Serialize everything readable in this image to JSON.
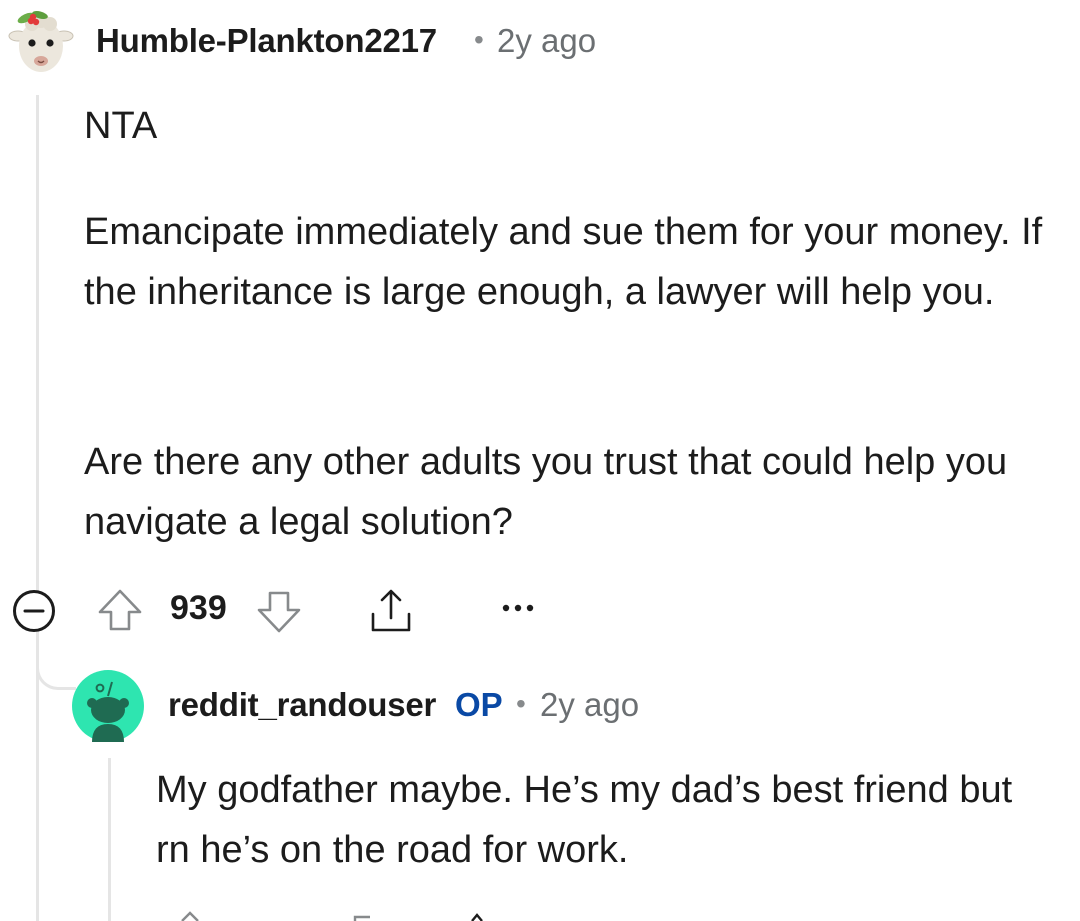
{
  "comment": {
    "username": "Humble-Plankton2217",
    "separator": "•",
    "time": "2y ago",
    "avatar_icon": "snoo-llama-avatar-icon",
    "paragraphs": [
      "NTA",
      "Emancipate immediately and sue them for your money. If the inheritance is large enough, a lawyer will help you.",
      "Are there any other adults you trust that could help you navigate a legal solution?"
    ],
    "actions": {
      "collapse_icon": "minus-circle-icon",
      "upvote_icon": "arrow-up-icon",
      "score": "939",
      "downvote_icon": "arrow-down-icon",
      "share_icon": "share-icon",
      "more_icon": "more-horizontal-icon"
    }
  },
  "reply": {
    "username": "reddit_randouser",
    "op_badge": "OP",
    "separator": "•",
    "time": "2y ago",
    "avatar_icon": "snoo-avatar-icon",
    "text": "My godfather maybe. He’s my dad’s best friend but rn he’s on the road for work."
  },
  "colors": {
    "text": "#1c1c1c",
    "meta": "#6b6f72",
    "op": "#0a49a5",
    "thread": "#e5e5e5",
    "avatar_green": "#2ee5b0"
  }
}
